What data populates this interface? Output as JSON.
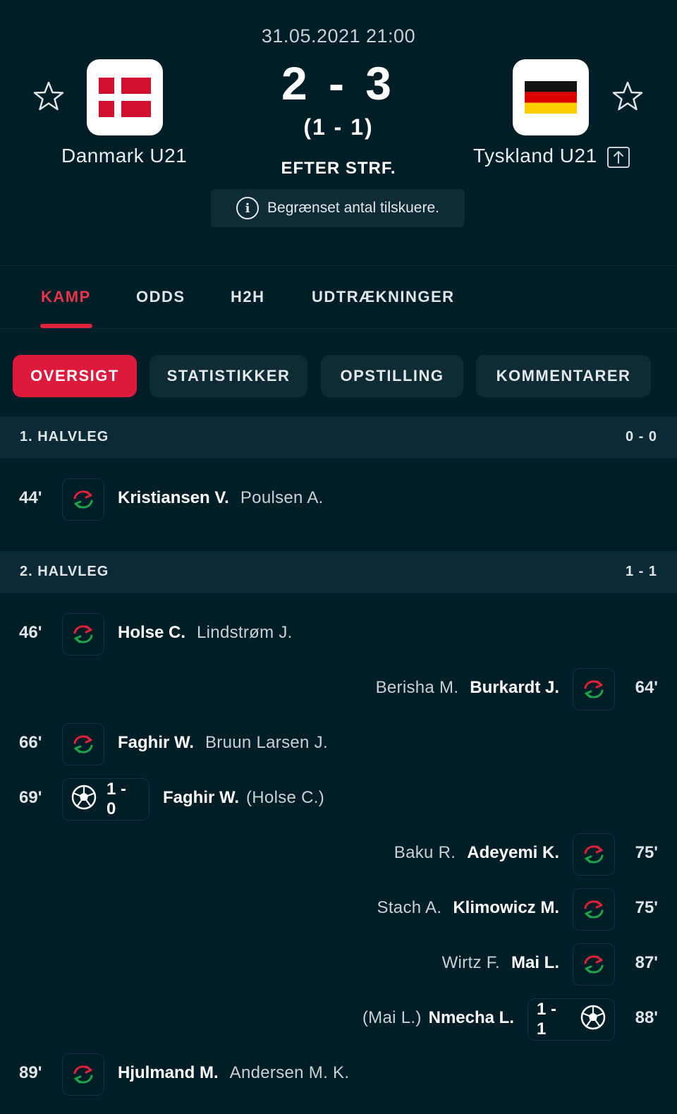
{
  "match": {
    "datetime": "31.05.2021 21:00",
    "score": "2 - 3",
    "halftime": "(1 - 1)",
    "status": "EFTER STRF.",
    "info": "Begrænset antal tilskuere.",
    "home": {
      "name": "Danmark U21",
      "flag": "denmark-flag"
    },
    "away": {
      "name": "Tyskland U21",
      "flag": "germany-flag"
    }
  },
  "tabs": [
    {
      "label": "KAMP",
      "active": true
    },
    {
      "label": "ODDS"
    },
    {
      "label": "H2H"
    },
    {
      "label": "UDTRÆKNINGER"
    }
  ],
  "subtabs": [
    {
      "label": "OVERSIGT",
      "active": true
    },
    {
      "label": "STATISTIKKER"
    },
    {
      "label": "OPSTILLING"
    },
    {
      "label": "KOMMENTARER"
    }
  ],
  "halves": [
    {
      "title": "1. HALVLEG",
      "score": "0 - 0"
    },
    {
      "title": "2. HALVLEG",
      "score": "1 - 1"
    }
  ],
  "events": [
    {
      "minute": "44'",
      "type": "substitution",
      "side": "home",
      "player_in": "Kristiansen V.",
      "player_out": "Poulsen A."
    },
    {
      "minute": "46'",
      "type": "substitution",
      "side": "home",
      "player_in": "Holse C.",
      "player_out": "Lindstrøm J."
    },
    {
      "minute": "64'",
      "type": "substitution",
      "side": "away",
      "player_in": "Burkardt J.",
      "player_out": "Berisha M."
    },
    {
      "minute": "66'",
      "type": "substitution",
      "side": "home",
      "player_in": "Faghir W.",
      "player_out": "Bruun Larsen J."
    },
    {
      "minute": "69'",
      "type": "goal",
      "side": "home",
      "score": "1 - 0",
      "scorer": "Faghir W.",
      "assist": "(Holse C.)"
    },
    {
      "minute": "75'",
      "type": "substitution",
      "side": "away",
      "player_in": "Adeyemi K.",
      "player_out": "Baku R."
    },
    {
      "minute": "75'",
      "type": "substitution",
      "side": "away",
      "player_in": "Klimowicz M.",
      "player_out": "Stach A."
    },
    {
      "minute": "87'",
      "type": "substitution",
      "side": "away",
      "player_in": "Mai L.",
      "player_out": "Wirtz F."
    },
    {
      "minute": "88'",
      "type": "goal",
      "side": "away",
      "score": "1 - 1",
      "scorer": "Nmecha L.",
      "assist": "(Mai L.)"
    },
    {
      "minute": "89'",
      "type": "substitution",
      "side": "home",
      "player_in": "Hjulmand M.",
      "player_out": "Andersen M. K."
    }
  ],
  "colors": {
    "background": "#001e28",
    "panel": "#0e2b36",
    "accent": "#dd1a3c",
    "sub_in_arrow": "#1fa347",
    "sub_out_arrow": "#e0213a"
  }
}
